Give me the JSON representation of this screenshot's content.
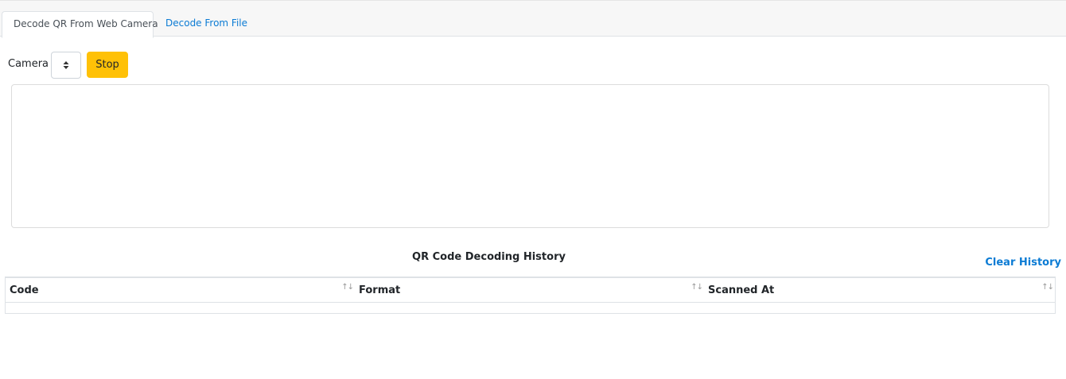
{
  "tabs": [
    {
      "label": "Decode QR From Web Camera",
      "active": true
    },
    {
      "label": "Decode From File",
      "active": false
    }
  ],
  "camera": {
    "label": "Camera",
    "stop_label": "Stop"
  },
  "history": {
    "title": "QR Code Decoding History",
    "clear_label": "Clear History",
    "columns": [
      "Code",
      "Format",
      "Scanned At"
    ],
    "sort_glyph": "↑↓",
    "rows": []
  },
  "colors": {
    "accent_link": "#0b7bd4",
    "stop_button": "#ffc107"
  }
}
